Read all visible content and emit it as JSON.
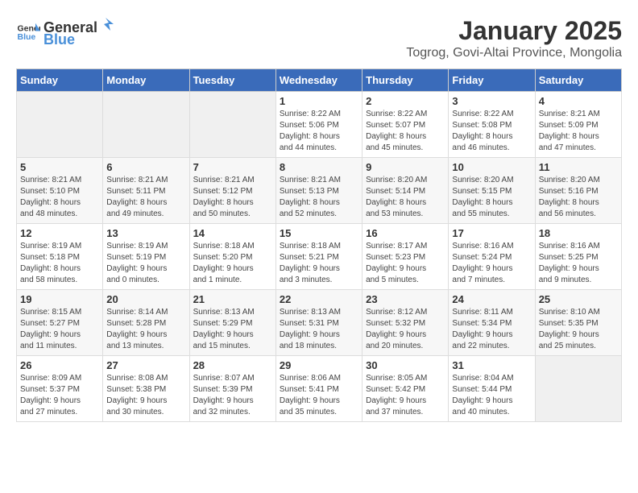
{
  "logo": {
    "general": "General",
    "blue": "Blue"
  },
  "title": "January 2025",
  "subtitle": "Togrog, Govi-Altai Province, Mongolia",
  "weekdays": [
    "Sunday",
    "Monday",
    "Tuesday",
    "Wednesday",
    "Thursday",
    "Friday",
    "Saturday"
  ],
  "weeks": [
    [
      {
        "day": "",
        "info": ""
      },
      {
        "day": "",
        "info": ""
      },
      {
        "day": "",
        "info": ""
      },
      {
        "day": "1",
        "info": "Sunrise: 8:22 AM\nSunset: 5:06 PM\nDaylight: 8 hours\nand 44 minutes."
      },
      {
        "day": "2",
        "info": "Sunrise: 8:22 AM\nSunset: 5:07 PM\nDaylight: 8 hours\nand 45 minutes."
      },
      {
        "day": "3",
        "info": "Sunrise: 8:22 AM\nSunset: 5:08 PM\nDaylight: 8 hours\nand 46 minutes."
      },
      {
        "day": "4",
        "info": "Sunrise: 8:21 AM\nSunset: 5:09 PM\nDaylight: 8 hours\nand 47 minutes."
      }
    ],
    [
      {
        "day": "5",
        "info": "Sunrise: 8:21 AM\nSunset: 5:10 PM\nDaylight: 8 hours\nand 48 minutes."
      },
      {
        "day": "6",
        "info": "Sunrise: 8:21 AM\nSunset: 5:11 PM\nDaylight: 8 hours\nand 49 minutes."
      },
      {
        "day": "7",
        "info": "Sunrise: 8:21 AM\nSunset: 5:12 PM\nDaylight: 8 hours\nand 50 minutes."
      },
      {
        "day": "8",
        "info": "Sunrise: 8:21 AM\nSunset: 5:13 PM\nDaylight: 8 hours\nand 52 minutes."
      },
      {
        "day": "9",
        "info": "Sunrise: 8:20 AM\nSunset: 5:14 PM\nDaylight: 8 hours\nand 53 minutes."
      },
      {
        "day": "10",
        "info": "Sunrise: 8:20 AM\nSunset: 5:15 PM\nDaylight: 8 hours\nand 55 minutes."
      },
      {
        "day": "11",
        "info": "Sunrise: 8:20 AM\nSunset: 5:16 PM\nDaylight: 8 hours\nand 56 minutes."
      }
    ],
    [
      {
        "day": "12",
        "info": "Sunrise: 8:19 AM\nSunset: 5:18 PM\nDaylight: 8 hours\nand 58 minutes."
      },
      {
        "day": "13",
        "info": "Sunrise: 8:19 AM\nSunset: 5:19 PM\nDaylight: 9 hours\nand 0 minutes."
      },
      {
        "day": "14",
        "info": "Sunrise: 8:18 AM\nSunset: 5:20 PM\nDaylight: 9 hours\nand 1 minute."
      },
      {
        "day": "15",
        "info": "Sunrise: 8:18 AM\nSunset: 5:21 PM\nDaylight: 9 hours\nand 3 minutes."
      },
      {
        "day": "16",
        "info": "Sunrise: 8:17 AM\nSunset: 5:23 PM\nDaylight: 9 hours\nand 5 minutes."
      },
      {
        "day": "17",
        "info": "Sunrise: 8:16 AM\nSunset: 5:24 PM\nDaylight: 9 hours\nand 7 minutes."
      },
      {
        "day": "18",
        "info": "Sunrise: 8:16 AM\nSunset: 5:25 PM\nDaylight: 9 hours\nand 9 minutes."
      }
    ],
    [
      {
        "day": "19",
        "info": "Sunrise: 8:15 AM\nSunset: 5:27 PM\nDaylight: 9 hours\nand 11 minutes."
      },
      {
        "day": "20",
        "info": "Sunrise: 8:14 AM\nSunset: 5:28 PM\nDaylight: 9 hours\nand 13 minutes."
      },
      {
        "day": "21",
        "info": "Sunrise: 8:13 AM\nSunset: 5:29 PM\nDaylight: 9 hours\nand 15 minutes."
      },
      {
        "day": "22",
        "info": "Sunrise: 8:13 AM\nSunset: 5:31 PM\nDaylight: 9 hours\nand 18 minutes."
      },
      {
        "day": "23",
        "info": "Sunrise: 8:12 AM\nSunset: 5:32 PM\nDaylight: 9 hours\nand 20 minutes."
      },
      {
        "day": "24",
        "info": "Sunrise: 8:11 AM\nSunset: 5:34 PM\nDaylight: 9 hours\nand 22 minutes."
      },
      {
        "day": "25",
        "info": "Sunrise: 8:10 AM\nSunset: 5:35 PM\nDaylight: 9 hours\nand 25 minutes."
      }
    ],
    [
      {
        "day": "26",
        "info": "Sunrise: 8:09 AM\nSunset: 5:37 PM\nDaylight: 9 hours\nand 27 minutes."
      },
      {
        "day": "27",
        "info": "Sunrise: 8:08 AM\nSunset: 5:38 PM\nDaylight: 9 hours\nand 30 minutes."
      },
      {
        "day": "28",
        "info": "Sunrise: 8:07 AM\nSunset: 5:39 PM\nDaylight: 9 hours\nand 32 minutes."
      },
      {
        "day": "29",
        "info": "Sunrise: 8:06 AM\nSunset: 5:41 PM\nDaylight: 9 hours\nand 35 minutes."
      },
      {
        "day": "30",
        "info": "Sunrise: 8:05 AM\nSunset: 5:42 PM\nDaylight: 9 hours\nand 37 minutes."
      },
      {
        "day": "31",
        "info": "Sunrise: 8:04 AM\nSunset: 5:44 PM\nDaylight: 9 hours\nand 40 minutes."
      },
      {
        "day": "",
        "info": ""
      }
    ]
  ]
}
